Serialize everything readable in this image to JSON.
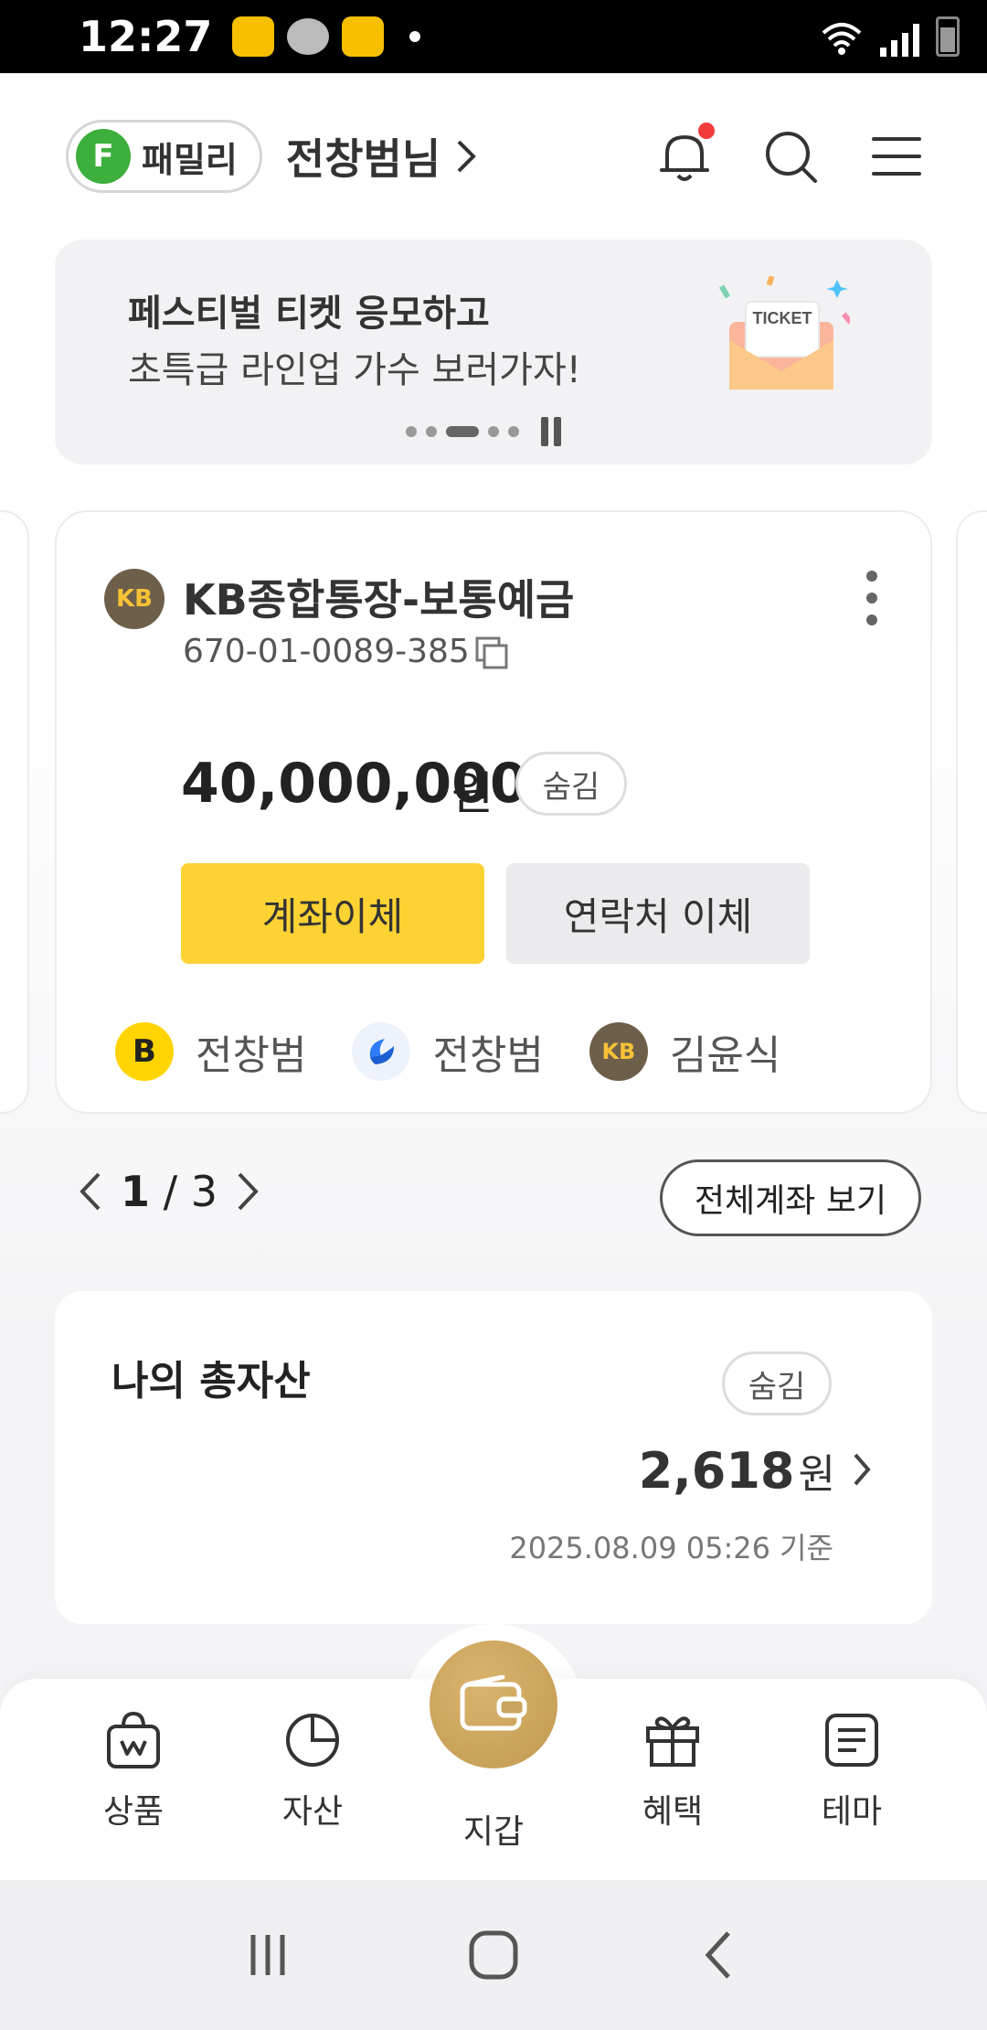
{
  "status_bar": {
    "time": "12:27"
  },
  "header": {
    "family_badge_letter": "F",
    "family_label": "패밀리",
    "user_name": "전창범님",
    "icons": [
      "bell-icon",
      "search-icon",
      "menu-icon"
    ],
    "notification_dot_color": "#f23b3b"
  },
  "banner": {
    "title": "페스티벌 티켓 응모하고",
    "subtitle": "초특급 라인업 가수 보러가자!",
    "ticket_text": "TICKET",
    "dots_total": 5,
    "active_dot": 3
  },
  "account": {
    "logo_text": "KB",
    "name": "KB종합통장-보통예금",
    "number": "670-01-0089-385",
    "balance": "40,000,000",
    "balance_unit": "원",
    "hide_label": "숨김",
    "transfer_label": "계좌이체",
    "contact_transfer_label": "연락처 이체",
    "recents": [
      {
        "avatar": "B",
        "name": "전창범"
      },
      {
        "avatar": "toss",
        "name": "전창범"
      },
      {
        "avatar": "KB",
        "name": "김윤식"
      }
    ]
  },
  "pager": {
    "current": "1",
    "separator": "/",
    "total": "3",
    "all_accounts_label": "전체계좌 보기"
  },
  "assets": {
    "title": "나의 총자산",
    "hide_label": "숨김",
    "amount": "2,618",
    "amount_unit": "원",
    "date": "2025.08.09 05:26 기준"
  },
  "bottom_nav": {
    "items": [
      {
        "label": "상품",
        "icon": "shopping-bag-icon"
      },
      {
        "label": "자산",
        "icon": "pie-chart-icon"
      },
      {
        "label": "지갑",
        "icon": "wallet-icon"
      },
      {
        "label": "혜택",
        "icon": "gift-icon"
      },
      {
        "label": "테마",
        "icon": "document-icon"
      }
    ],
    "accent_color": "#c9a55e"
  },
  "colors": {
    "primary_yellow": "#fdd233",
    "family_green": "#3caf3c",
    "kb_brown": "#6e5f4a"
  }
}
